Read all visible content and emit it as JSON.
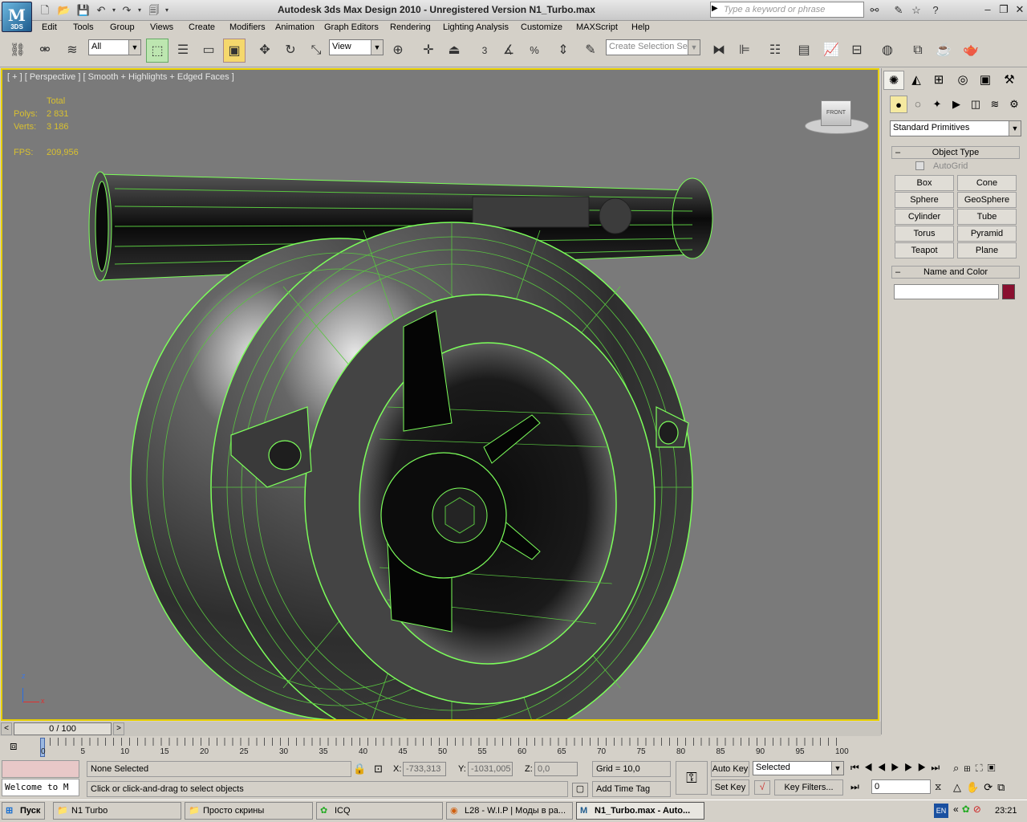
{
  "title_bar": {
    "app_title": "Autodesk 3ds Max Design 2010  -  Unregistered Version      N1_Turbo.max",
    "logo_caption": "3DS",
    "search_placeholder": "Type a keyword or phrase"
  },
  "menu": [
    "Edit",
    "Tools",
    "Group",
    "Views",
    "Create",
    "Modifiers",
    "Animation",
    "Graph Editors",
    "Rendering",
    "Lighting Analysis",
    "Customize",
    "MAXScript",
    "Help"
  ],
  "toolbar": {
    "selection_filter": "All",
    "ref_coord": "View",
    "named_selection_placeholder": "Create Selection Se",
    "snap_angle_label": "3",
    "percent_label": "%"
  },
  "viewport": {
    "label": "[ + ] [ Perspective ] [ Smooth + Highlights + Edged Faces ]",
    "stats_header": "Total",
    "polys_label": "Polys:",
    "polys_value": "2 831",
    "verts_label": "Verts:",
    "verts_value": "3 186",
    "fps_label": "FPS:",
    "fps_value": "209,956",
    "viewcube_label": "FRONT",
    "axis": {
      "z": "z",
      "x": "x"
    }
  },
  "command_panel": {
    "dropdown": "Standard Primitives",
    "object_type_header": "Object Type",
    "autogrid_label": "AutoGrid",
    "buttons": [
      "Box",
      "Cone",
      "Sphere",
      "GeoSphere",
      "Cylinder",
      "Tube",
      "Torus",
      "Pyramid",
      "Teapot",
      "Plane"
    ],
    "name_color_header": "Name and Color",
    "name_value": "",
    "color": "#8a1030"
  },
  "timeline": {
    "frame_counter": "0 / 100",
    "ticks": [
      "0",
      "5",
      "10",
      "15",
      "20",
      "25",
      "30",
      "35",
      "40",
      "45",
      "50",
      "55",
      "60",
      "65",
      "70",
      "75",
      "80",
      "85",
      "90",
      "95",
      "100"
    ]
  },
  "status": {
    "maxscript": "Welcome to M",
    "selection": "None Selected",
    "prompt": "Click or click-and-drag to select objects",
    "x_label": "X:",
    "x_value": "-733,313",
    "y_label": "Y:",
    "y_value": "-1031,005",
    "z_label": "Z:",
    "z_value": "0,0",
    "grid": "Grid = 10,0",
    "add_time_tag": "Add Time Tag",
    "auto_key": "Auto Key",
    "set_key": "Set Key",
    "key_mode": "Selected",
    "key_filters": "Key Filters...",
    "frame_field": "0"
  },
  "taskbar": {
    "start": "Пуск",
    "tasks": [
      "N1 Turbo",
      "Просто скрины",
      "ICQ",
      "L28 - W.I.P | Моды в ра...",
      "N1_Turbo.max - Auto..."
    ],
    "lang": "EN",
    "clock": "23:21"
  },
  "colors": {
    "wire": "#7cff5a",
    "viewport_bg": "#7a7a7a",
    "active_border": "#e8d000",
    "stats": "#d8c030"
  }
}
